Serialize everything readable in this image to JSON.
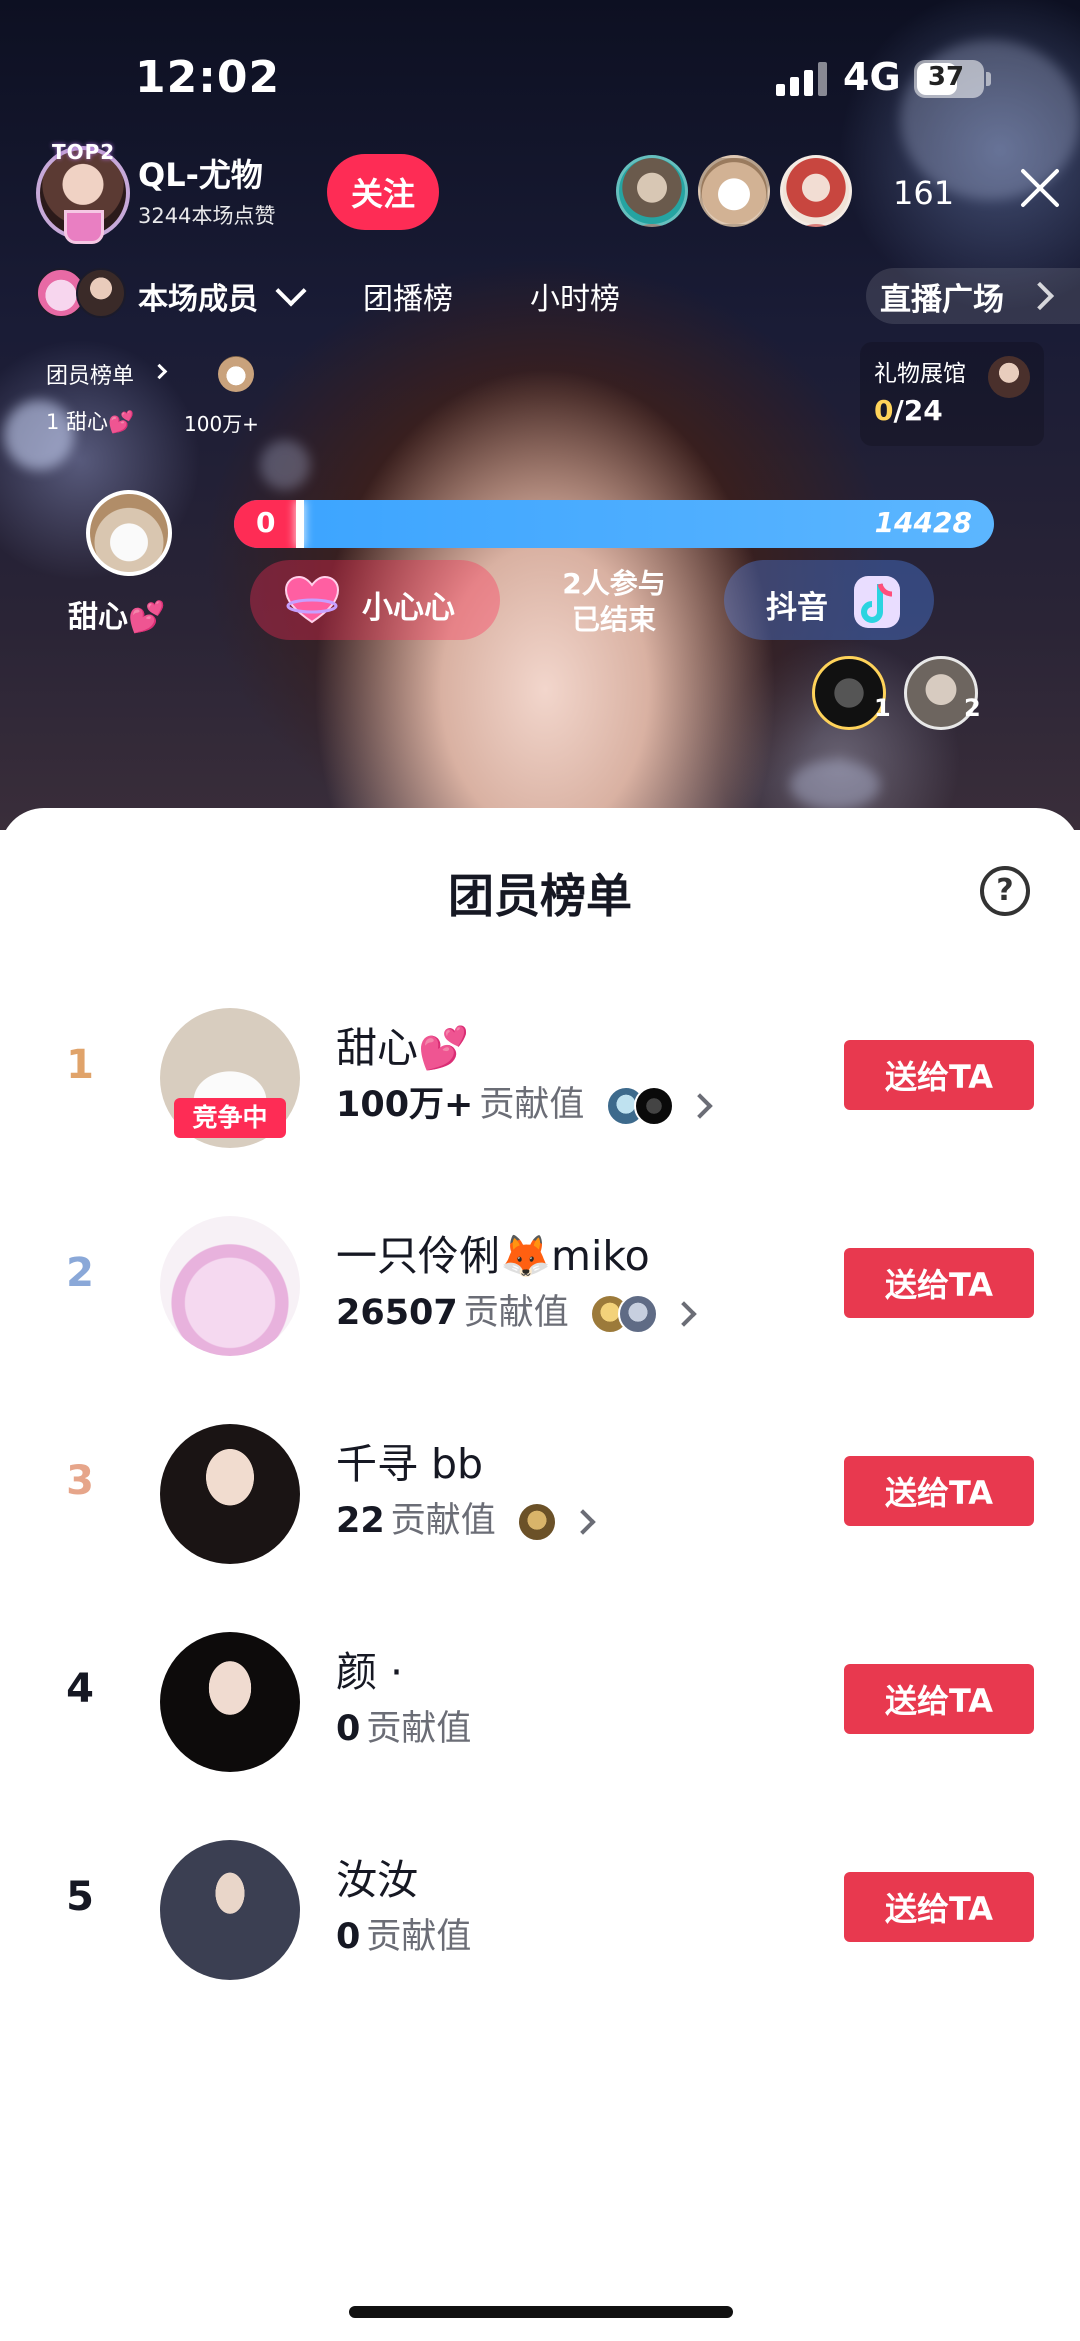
{
  "status_bar": {
    "time": "12:02",
    "network": "4G",
    "battery": "37"
  },
  "host": {
    "badge": "TOP2",
    "name": "QL-尤物",
    "likes": "3244本场点赞",
    "follow_label": "关注"
  },
  "viewers": {
    "count": "161"
  },
  "tabs": {
    "members": "本场成员",
    "team_board": "团播榜",
    "hourly": "小时榜",
    "plaza": "直播广场"
  },
  "mini_board": {
    "title": "团员榜单",
    "rank_line": "1 甜心💕",
    "value": "100万+"
  },
  "gift_hall": {
    "title": "礼物展馆",
    "collected": "0",
    "total": "/24"
  },
  "pk": {
    "left_name": "甜心💕",
    "left_score": "0",
    "right_score": "14428",
    "left_team": "小心心",
    "status_line1": "2人参与",
    "status_line2": "已结束",
    "right_team": "抖音",
    "rank_labels": [
      "1",
      "2"
    ]
  },
  "sheet": {
    "title": "团员榜单",
    "help_icon": "?",
    "send_label": "送给TA",
    "contrib_label": "贡献值",
    "competing_label": "竞争中",
    "entries": [
      {
        "rank": "1",
        "name": "甜心💕",
        "value": "100万+",
        "rank_color": "#e0a36a"
      },
      {
        "rank": "2",
        "name": "一只伶俐🦊miko",
        "value": "26507",
        "rank_color": "#8aa8d8"
      },
      {
        "rank": "3",
        "name": "千寻 bb",
        "value": "22",
        "rank_color": "#e6a58a"
      },
      {
        "rank": "4",
        "name": "颜 ·",
        "value": "0",
        "rank_color": "#161823"
      },
      {
        "rank": "5",
        "name": "汝汝",
        "value": "0",
        "rank_color": "#161823"
      }
    ]
  },
  "colors": {
    "accent": "#fe2c55",
    "send_button": "#e8394f",
    "pk_blue": "#3aa3ff",
    "gold": "#ffd35a"
  }
}
